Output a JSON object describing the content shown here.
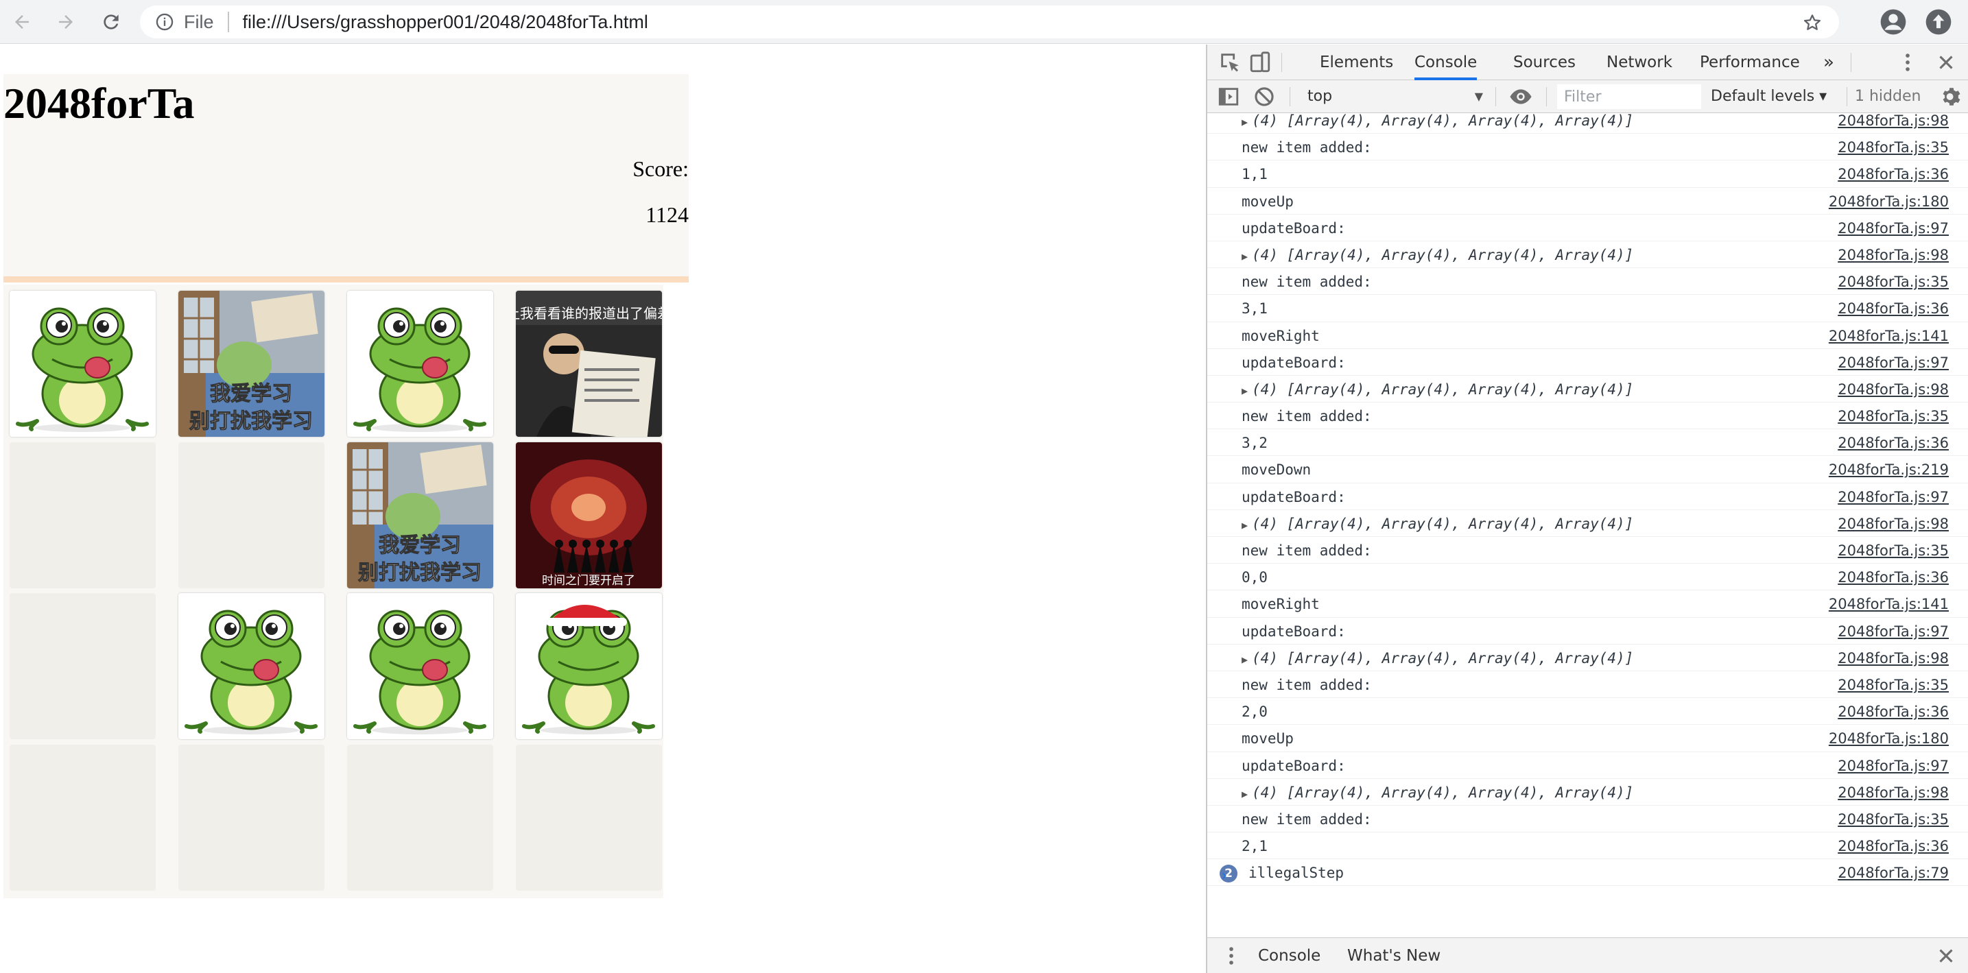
{
  "browser": {
    "scheme_label": "File",
    "url": "file:///Users/grasshopper001/2048/2048forTa.html"
  },
  "game": {
    "title": "2048forTa",
    "score_label": "Score:",
    "score_value": "1124",
    "board": [
      [
        "frog",
        "study-frog",
        "frog",
        "newspaper-meme"
      ],
      [
        "empty",
        "empty",
        "study-frog",
        "time-gate-meme"
      ],
      [
        "empty",
        "frog",
        "frog",
        "christmas-frog"
      ],
      [
        "empty",
        "empty",
        "empty",
        "empty"
      ]
    ],
    "tile_texts": {
      "study_line1": "我爱学习",
      "study_line2": "别打扰我学习",
      "newspaper": "让我看看谁的报道出了偏差",
      "time_gate": "时间之门要开启了"
    }
  },
  "devtools": {
    "tabs": [
      "Elements",
      "Console",
      "Sources",
      "Network",
      "Performance"
    ],
    "more_tabs": "»",
    "active_tab": "Console",
    "context": "top",
    "filter_placeholder": "Filter",
    "levels": "Default levels ▾",
    "hidden": "1 hidden",
    "logs": [
      {
        "msg": "(4) [Array(4), Array(4), Array(4), Array(4)]",
        "src": "2048forTa.js:98",
        "type": "obj"
      },
      {
        "msg": "new item added:",
        "src": "2048forTa.js:35"
      },
      {
        "msg": "1,1",
        "src": "2048forTa.js:36"
      },
      {
        "msg": "moveUp",
        "src": "2048forTa.js:180"
      },
      {
        "msg": "updateBoard:",
        "src": "2048forTa.js:97"
      },
      {
        "msg": "(4) [Array(4), Array(4), Array(4), Array(4)]",
        "src": "2048forTa.js:98",
        "type": "obj"
      },
      {
        "msg": "new item added:",
        "src": "2048forTa.js:35"
      },
      {
        "msg": "3,1",
        "src": "2048forTa.js:36"
      },
      {
        "msg": "moveRight",
        "src": "2048forTa.js:141"
      },
      {
        "msg": "updateBoard:",
        "src": "2048forTa.js:97"
      },
      {
        "msg": "(4) [Array(4), Array(4), Array(4), Array(4)]",
        "src": "2048forTa.js:98",
        "type": "obj"
      },
      {
        "msg": "new item added:",
        "src": "2048forTa.js:35"
      },
      {
        "msg": "3,2",
        "src": "2048forTa.js:36"
      },
      {
        "msg": "moveDown",
        "src": "2048forTa.js:219"
      },
      {
        "msg": "updateBoard:",
        "src": "2048forTa.js:97"
      },
      {
        "msg": "(4) [Array(4), Array(4), Array(4), Array(4)]",
        "src": "2048forTa.js:98",
        "type": "obj"
      },
      {
        "msg": "new item added:",
        "src": "2048forTa.js:35"
      },
      {
        "msg": "0,0",
        "src": "2048forTa.js:36"
      },
      {
        "msg": "moveRight",
        "src": "2048forTa.js:141"
      },
      {
        "msg": "updateBoard:",
        "src": "2048forTa.js:97"
      },
      {
        "msg": "(4) [Array(4), Array(4), Array(4), Array(4)]",
        "src": "2048forTa.js:98",
        "type": "obj"
      },
      {
        "msg": "new item added:",
        "src": "2048forTa.js:35"
      },
      {
        "msg": "2,0",
        "src": "2048forTa.js:36"
      },
      {
        "msg": "moveUp",
        "src": "2048forTa.js:180"
      },
      {
        "msg": "updateBoard:",
        "src": "2048forTa.js:97"
      },
      {
        "msg": "(4) [Array(4), Array(4), Array(4), Array(4)]",
        "src": "2048forTa.js:98",
        "type": "obj"
      },
      {
        "msg": "new item added:",
        "src": "2048forTa.js:35"
      },
      {
        "msg": "2,1",
        "src": "2048forTa.js:36"
      },
      {
        "msg": "illegalStep",
        "src": "2048forTa.js:79",
        "count": "2"
      }
    ],
    "prompt": "›",
    "drawer_tabs": [
      "Console",
      "What's New"
    ]
  }
}
